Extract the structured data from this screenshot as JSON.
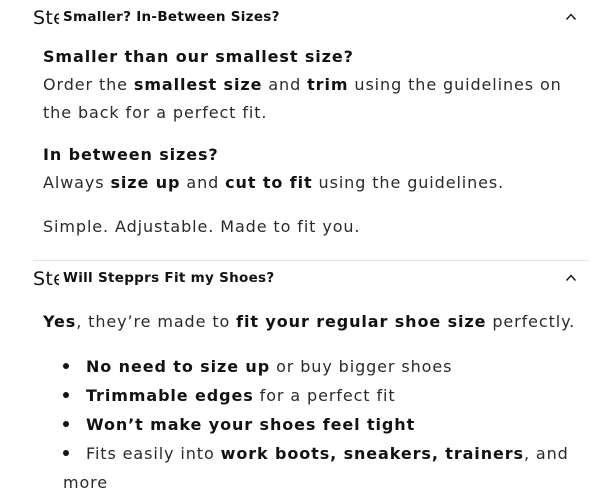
{
  "accordion1": {
    "prefix": "Steppr",
    "title": "Smaller? In-Between Sizes?",
    "q1": "Smaller than our smallest size?",
    "p1": {
      "a": "Order the ",
      "b": "smallest size",
      "c": " and ",
      "d": "trim",
      "e": " using the guidelines on the back for a perfect fit."
    },
    "q2": "In between sizes?",
    "p2": {
      "a": "Always ",
      "b": "size up",
      "c": " and ",
      "d": "cut to fit",
      "e": " using the guidelines."
    },
    "p3": "Simple. Adjustable. Made to fit you."
  },
  "accordion2": {
    "prefix": "Steppr",
    "title": "Will Stepprs Fit my Shoes?",
    "intro": {
      "a": "Yes",
      "b": ", they’re made to ",
      "c": "fit your regular shoe size",
      "d": " perfectly."
    },
    "bullets": [
      {
        "bold": "No need to size up",
        "rest": " or buy bigger shoes"
      },
      {
        "bold": "Trimmable edges",
        "rest": " for a perfect fit"
      },
      {
        "bold": "Won’t make your shoes feel tight",
        "rest": ""
      },
      {
        "pre": "Fits easily into ",
        "bold": "work boots, sneakers, trainers",
        "rest": ", and more"
      }
    ]
  },
  "icons": {
    "caret": "chevron-up-icon"
  }
}
